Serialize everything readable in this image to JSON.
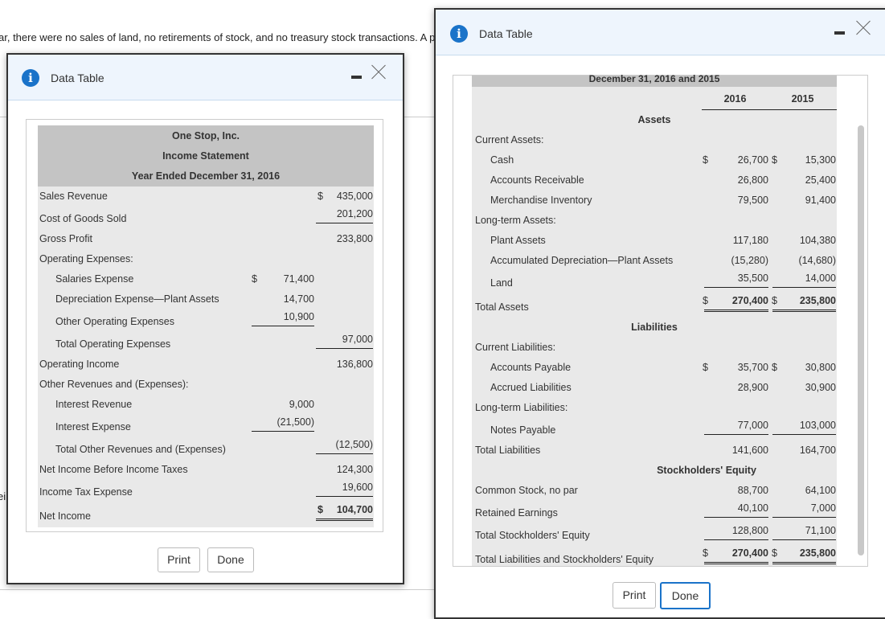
{
  "background": {
    "question_text": "ar, there were no sales of land, no retirements of stock, and no treasury stock transactions. A p",
    "cut_text": "ei"
  },
  "left_dialog": {
    "title": "Data Table",
    "icon": "info-icon",
    "header": [
      "One Stop, Inc.",
      "Income Statement",
      "Year Ended December 31, 2016"
    ],
    "rows": [
      {
        "label": "Sales Revenue",
        "indent": 0,
        "c2d": "$",
        "c2": "435,000"
      },
      {
        "label": "Cost of Goods Sold",
        "indent": 0,
        "c2": "201,200",
        "c2u": "ul"
      },
      {
        "label": "Gross Profit",
        "indent": 0,
        "c2": "233,800"
      },
      {
        "label": "Operating Expenses:",
        "indent": 0
      },
      {
        "label": "Salaries Expense",
        "indent": 1,
        "c1d": "$",
        "c1": "71,400"
      },
      {
        "label": "Depreciation Expense—Plant Assets",
        "indent": 1,
        "c1": "14,700"
      },
      {
        "label": "Other Operating Expenses",
        "indent": 1,
        "c1": "10,900",
        "c1u": "ul"
      },
      {
        "label": "Total Operating Expenses",
        "indent": 1,
        "c2": "97,000",
        "c2u": "ul"
      },
      {
        "label": "Operating Income",
        "indent": 0,
        "c2": "136,800"
      },
      {
        "label": "Other Revenues and (Expenses):",
        "indent": 0
      },
      {
        "label": "Interest Revenue",
        "indent": 1,
        "c1": "9,000"
      },
      {
        "label": "Interest Expense",
        "indent": 1,
        "c1": "(21,500)",
        "c1u": "ul"
      },
      {
        "label": "Total Other Revenues and (Expenses)",
        "indent": 1,
        "c2": "(12,500)",
        "c2u": "ul"
      },
      {
        "label": "Net Income Before Income Taxes",
        "indent": 0,
        "c2": "124,300"
      },
      {
        "label": "Income Tax Expense",
        "indent": 0,
        "c2": "19,600",
        "c2u": "ul"
      },
      {
        "label": "Net Income",
        "indent": 0,
        "c2d": "$",
        "c2": "104,700",
        "c2u": "dul",
        "bold": true
      }
    ],
    "print_label": "Print",
    "done_label": "Done"
  },
  "right_dialog": {
    "title": "Data Table",
    "icon": "info-icon",
    "header": "December 31, 2016 and 2015",
    "years": [
      "2016",
      "2015"
    ],
    "rows": [
      {
        "label": "Assets",
        "section": true
      },
      {
        "label": "Current Assets:",
        "indent": 0
      },
      {
        "label": "Cash",
        "indent": 1,
        "c1d": "$",
        "c1": "26,700",
        "c2d": "$",
        "c2": "15,300"
      },
      {
        "label": "Accounts Receivable",
        "indent": 1,
        "c1": "26,800",
        "c2": "25,400"
      },
      {
        "label": "Merchandise Inventory",
        "indent": 1,
        "c1": "79,500",
        "c2": "91,400"
      },
      {
        "label": "Long-term Assets:",
        "indent": 0
      },
      {
        "label": "Plant Assets",
        "indent": 1,
        "c1": "117,180",
        "c2": "104,380"
      },
      {
        "label": "Accumulated Depreciation—Plant Assets",
        "indent": 1,
        "c1": "(15,280)",
        "c2": "(14,680)"
      },
      {
        "label": "Land",
        "indent": 1,
        "c1": "35,500",
        "c2": "14,000",
        "c1u": "ul",
        "c2u": "ul"
      },
      {
        "label": "Total Assets",
        "indent": 0,
        "c1d": "$",
        "c1": "270,400",
        "c2d": "$",
        "c2": "235,800",
        "bold": true,
        "c1u": "dul",
        "c2u": "dul"
      },
      {
        "label": "Liabilities",
        "section": true
      },
      {
        "label": "Current Liabilities:",
        "indent": 0
      },
      {
        "label": "Accounts Payable",
        "indent": 1,
        "c1d": "$",
        "c1": "35,700",
        "c2d": "$",
        "c2": "30,800"
      },
      {
        "label": "Accrued Liabilities",
        "indent": 1,
        "c1": "28,900",
        "c2": "30,900"
      },
      {
        "label": "Long-term Liabilities:",
        "indent": 0
      },
      {
        "label": "Notes Payable",
        "indent": 1,
        "c1": "77,000",
        "c2": "103,000",
        "c1u": "ul",
        "c2u": "ul"
      },
      {
        "label": "Total Liabilities",
        "indent": 0,
        "c1": "141,600",
        "c2": "164,700"
      },
      {
        "label": "Stockholders' Equity",
        "section": true
      },
      {
        "label": "Common Stock, no par",
        "indent": 0,
        "c1": "88,700",
        "c2": "64,100"
      },
      {
        "label": "Retained Earnings",
        "indent": 0,
        "c1": "40,100",
        "c2": "7,000",
        "c1u": "ul",
        "c2u": "ul"
      },
      {
        "label": "Total Stockholders' Equity",
        "indent": 0,
        "c1": "128,800",
        "c2": "71,100",
        "c1u": "ul",
        "c2u": "ul"
      },
      {
        "label": "Total Liabilities and Stockholders' Equity",
        "indent": 0,
        "c1d": "$",
        "c1": "270,400",
        "c2d": "$",
        "c2": "235,800",
        "bold": true,
        "c1u": "dul",
        "c2u": "dul"
      }
    ],
    "print_label": "Print",
    "done_label": "Done"
  },
  "colors": {
    "header_bg": "#eef5fd",
    "accent": "#1a73c9",
    "table_bg": "#e9e9e9",
    "band": "#c4c4c4"
  }
}
